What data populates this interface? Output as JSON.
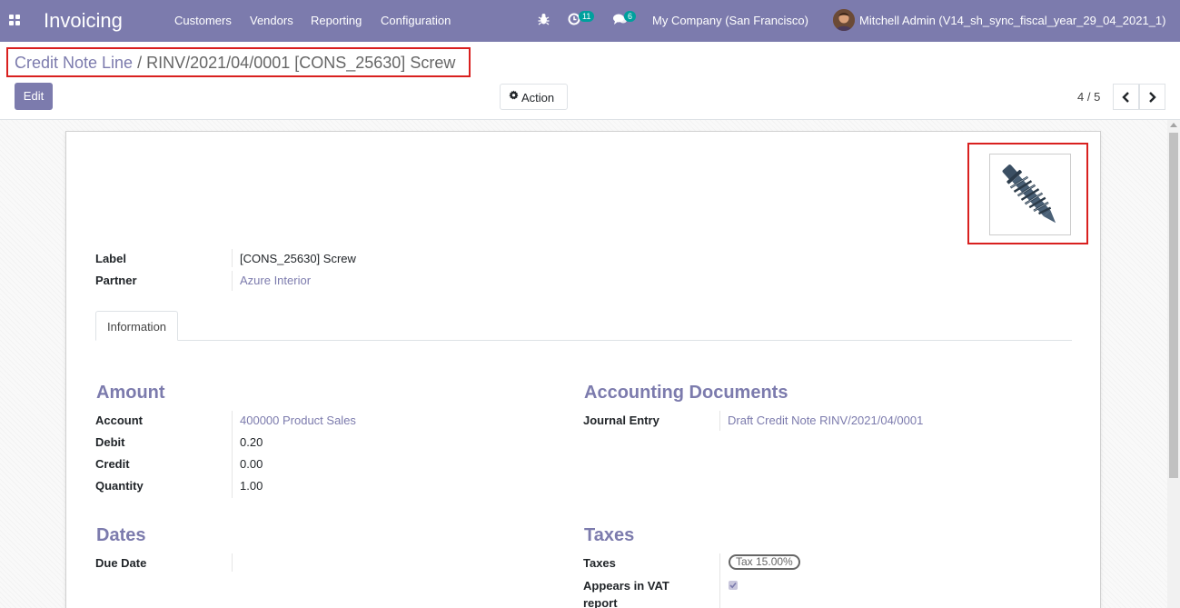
{
  "navbar": {
    "brand": "Invoicing",
    "menu": [
      "Customers",
      "Vendors",
      "Reporting",
      "Configuration"
    ],
    "activity_count": "11",
    "messages_count": "6",
    "company": "My Company (San Francisco)",
    "user": "Mitchell Admin (V14_sh_sync_fiscal_year_29_04_2021_1)"
  },
  "control_panel": {
    "breadcrumb_parent": "Credit Note Line",
    "breadcrumb_separator": "/",
    "breadcrumb_current": "RINV/2021/04/0001 [CONS_25630] Screw",
    "edit_label": "Edit",
    "action_label": "Action",
    "pager": "4 / 5"
  },
  "form": {
    "label_label": "Label",
    "label_value": "[CONS_25630] Screw",
    "partner_label": "Partner",
    "partner_value": "Azure Interior",
    "tab_information": "Information",
    "amount": {
      "title": "Amount",
      "account_label": "Account",
      "account_value": "400000 Product Sales",
      "debit_label": "Debit",
      "debit_value": "0.20",
      "credit_label": "Credit",
      "credit_value": "0.00",
      "quantity_label": "Quantity",
      "quantity_value": "1.00"
    },
    "accounting_documents": {
      "title": "Accounting Documents",
      "journal_entry_label": "Journal Entry",
      "journal_entry_value": "Draft Credit Note RINV/2021/04/0001"
    },
    "dates": {
      "title": "Dates",
      "due_date_label": "Due Date",
      "due_date_value": ""
    },
    "taxes": {
      "title": "Taxes",
      "taxes_label": "Taxes",
      "tax_tag": "Tax 15.00%",
      "vat_label_line1": "Appears in VAT",
      "vat_label_line2": "report",
      "vat_checked": true
    }
  },
  "colors": {
    "brand": "#7c7bad",
    "highlight": "#d9201f",
    "badge": "#00a09d"
  }
}
